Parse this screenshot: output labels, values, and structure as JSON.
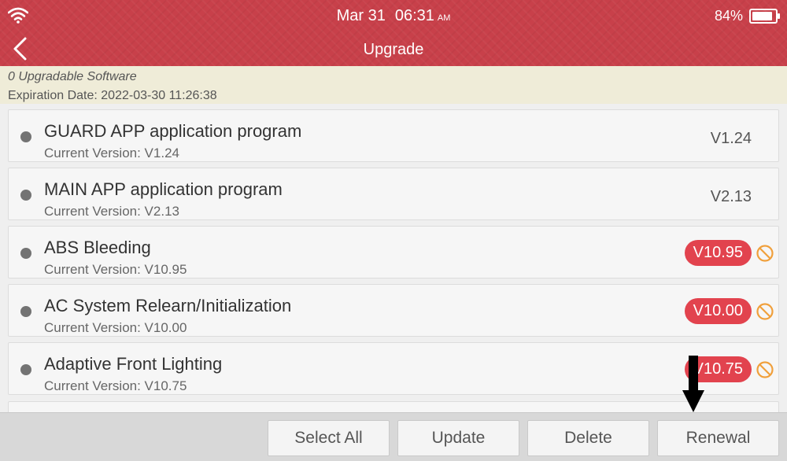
{
  "status_bar": {
    "date": "Mar 31",
    "time": "06:31",
    "ampm": "AM",
    "battery_percent": "84%",
    "battery_level": 0.84,
    "wifi_icon": "wifi-icon"
  },
  "header": {
    "title": "Upgrade",
    "back_icon": "chevron-left-icon",
    "color": "#c8404a"
  },
  "info": {
    "upgradable_count": "0 Upgradable Software",
    "expiration": "Expiration Date: 2022-03-30 11:26:38"
  },
  "items": [
    {
      "name": "GUARD APP application program",
      "current": "Current Version: V1.24",
      "version": "V1.24",
      "highlight": false
    },
    {
      "name": "MAIN APP application program",
      "current": "Current Version: V2.13",
      "version": "V2.13",
      "highlight": false
    },
    {
      "name": "ABS Bleeding",
      "current": "Current Version: V10.95",
      "version": "V10.95",
      "highlight": true
    },
    {
      "name": "AC System Relearn/Initialization",
      "current": "Current Version: V10.00",
      "version": "V10.00",
      "highlight": true
    },
    {
      "name": "Adaptive Front Lighting",
      "current": "Current Version: V10.75",
      "version": "V10.75",
      "highlight": true
    }
  ],
  "buttons": {
    "select_all": "Select All",
    "update": "Update",
    "delete": "Delete",
    "renewal": "Renewal"
  },
  "colors": {
    "badge": "#e2434e",
    "ban_icon": "#f0a03c"
  }
}
